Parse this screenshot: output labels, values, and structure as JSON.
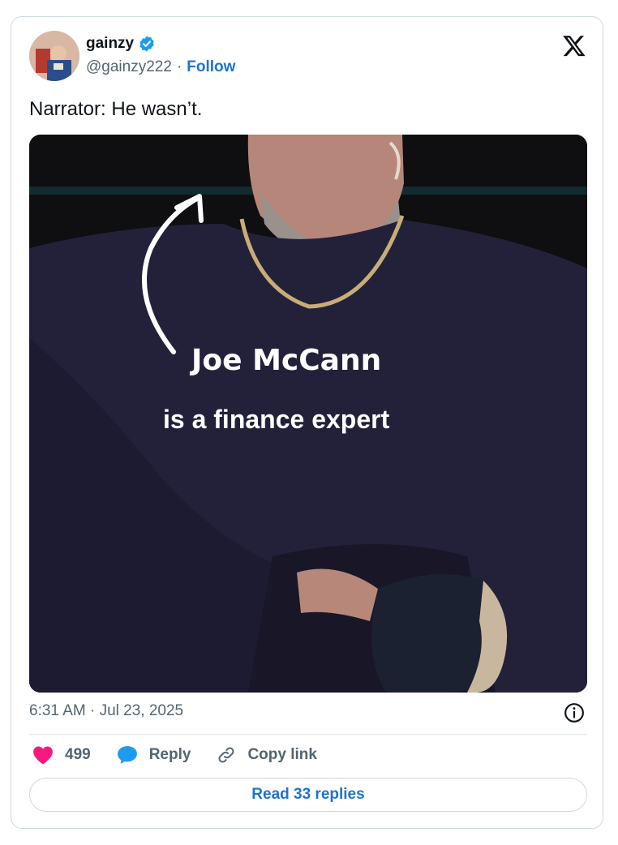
{
  "author": {
    "display_name": "gainzy",
    "handle": "@gainzy222",
    "separator": "·",
    "follow_label": "Follow"
  },
  "tweet": {
    "text": "Narrator: He wasn’t.",
    "timestamp": "6:31 AM · Jul 23, 2025"
  },
  "media": {
    "overlay_line1": "Joe McCann",
    "overlay_line2": "is a finance expert"
  },
  "actions": {
    "like_count": "499",
    "reply_label": "Reply",
    "copy_link_label": "Copy link"
  },
  "read_replies_label": "Read 33 replies",
  "colors": {
    "like": "#f91880",
    "reply": "#1d9bf0",
    "link": "#1d73d2",
    "verified": "#1d9bf0"
  },
  "icons": [
    "verified-badge-icon",
    "x-logo-icon",
    "info-icon",
    "heart-icon",
    "reply-bubble-icon",
    "link-icon"
  ]
}
